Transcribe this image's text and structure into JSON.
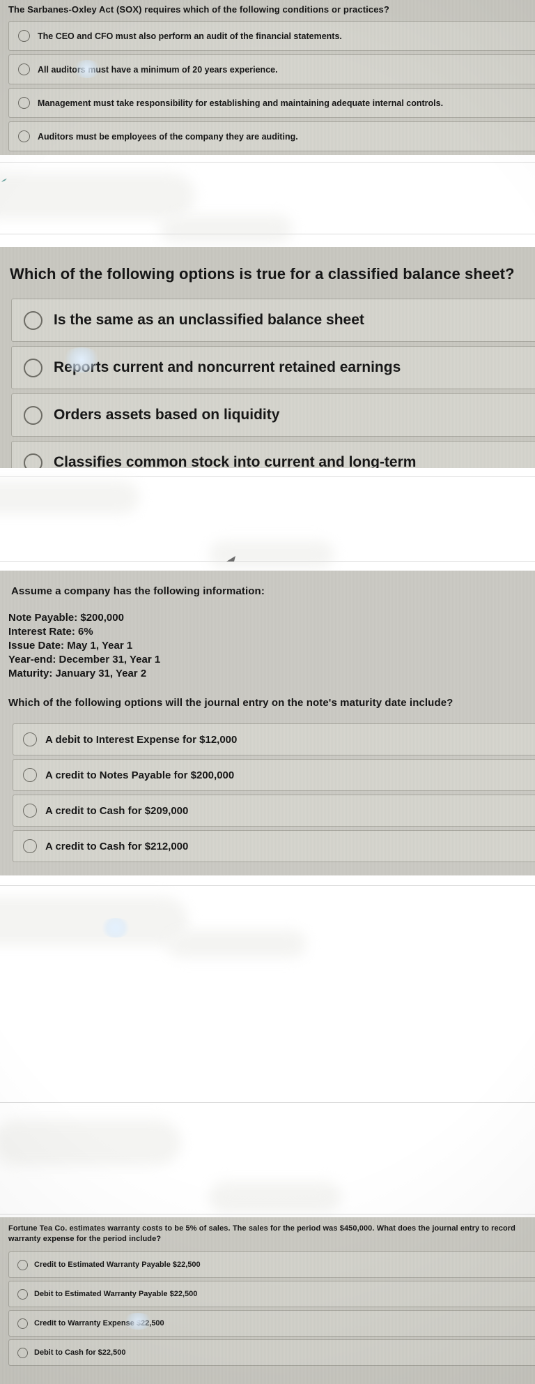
{
  "questions": [
    {
      "id": "sox-question",
      "prompt": "The Sarbanes-Oxley Act (SOX) requires which of the following conditions or practices?",
      "options": [
        "The CEO and CFO must also perform an audit of the financial statements.",
        "All auditors must have a minimum of 20 years experience.",
        "Management must take responsibility for establishing and maintaining adequate internal controls.",
        "Auditors must be employees of the company they are auditing."
      ]
    },
    {
      "id": "classified-balance-sheet-question",
      "prompt_before": "Which of the following options is ",
      "prompt_emphasis": "true",
      "prompt_after": " for a classified balance sheet?",
      "options": [
        "Is the same as an unclassified balance sheet",
        "Reports current and noncurrent retained earnings",
        "Orders assets based on liquidity",
        "Classifies common stock into current and long-term"
      ]
    },
    {
      "id": "note-payable-maturity-question",
      "prompt": "Assume a company has the following information:",
      "info": [
        "Note Payable: $200,000",
        "Interest Rate: 6%",
        "Issue Date: May 1, Year 1",
        "Year-end: December 31, Year 1",
        "Maturity: January 31, Year 2"
      ],
      "prompt_2": "Which of the following options will the journal entry on the note's maturity date include?",
      "options": [
        "A debit to Interest Expense for $12,000",
        "A credit to Notes Payable for $200,000",
        "A credit to Cash for $209,000",
        "A credit to Cash for $212,000"
      ]
    },
    {
      "id": "warranty-expense-question",
      "prompt": "Fortune Tea Co. estimates warranty costs to be 5% of sales. The sales for the period was $450,000. What does the journal entry to record warranty expense for the period include?",
      "options": [
        "Credit to Estimated Warranty Payable $22,500",
        "Debit to Estimated Warranty Payable $22,500",
        "Credit to Warranty Expense $22,500",
        "Debit to Cash for $22,500"
      ]
    }
  ],
  "colors": {
    "panel_background": "#cbcac3",
    "option_background": "#d6d5ce",
    "option_border": "#a9a8a0",
    "radio_border": "#6e6d66",
    "text": "#171717",
    "page_background": "#ffffff",
    "divider": "#dcdcdc"
  },
  "icons": {
    "radio_unselected": "radio-unselected-icon"
  }
}
